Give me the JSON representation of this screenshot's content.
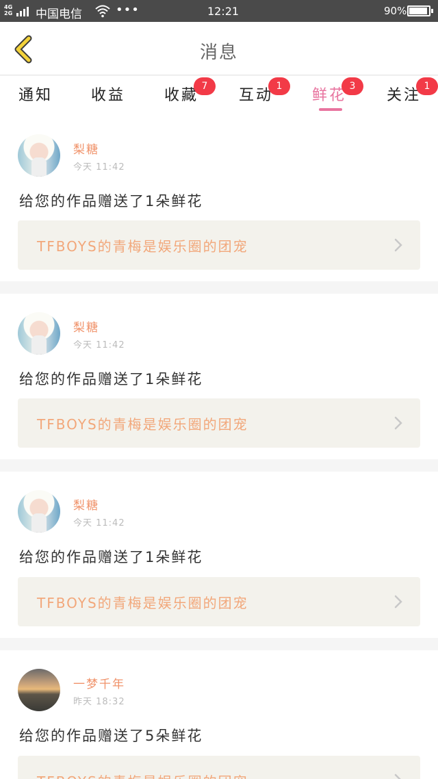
{
  "status_bar": {
    "network": [
      "4G",
      "2G"
    ],
    "carrier": "中国电信",
    "dots": "•••",
    "time": "12:21",
    "battery": "90%"
  },
  "header": {
    "title": "消息"
  },
  "tabs": [
    {
      "label": "通知",
      "badge": ""
    },
    {
      "label": "收益",
      "badge": ""
    },
    {
      "label": "收藏",
      "badge": "7"
    },
    {
      "label": "互动",
      "badge": "1"
    },
    {
      "label": "鲜花",
      "badge": "3",
      "active": true
    },
    {
      "label": "关注",
      "badge": "1"
    }
  ],
  "messages": [
    {
      "avatar": "girl-avatar",
      "name": "梨糖",
      "time": "今天 11:42",
      "text": "给您的作品赠送了1朵鲜花",
      "work_title": "TFBOYS的青梅是娱乐圈的团宠"
    },
    {
      "avatar": "girl-avatar",
      "name": "梨糖",
      "time": "今天 11:42",
      "text": "给您的作品赠送了1朵鲜花",
      "work_title": "TFBOYS的青梅是娱乐圈的团宠"
    },
    {
      "avatar": "girl-avatar",
      "name": "梨糖",
      "time": "今天 11:42",
      "text": "给您的作品赠送了1朵鲜花",
      "work_title": "TFBOYS的青梅是娱乐圈的团宠"
    },
    {
      "avatar": "sunset-avatar",
      "name": "一梦千年",
      "time": "昨天 18:32",
      "text": "给您的作品赠送了5朵鲜花",
      "work_title": "TFBOYS的青梅是娱乐圈的团宠"
    }
  ],
  "colors": {
    "accent": "#e8749f",
    "badge": "#f23a47",
    "name": "#f0936b",
    "work_title": "#f2a77a",
    "back_arrow": "#f3d23a"
  }
}
